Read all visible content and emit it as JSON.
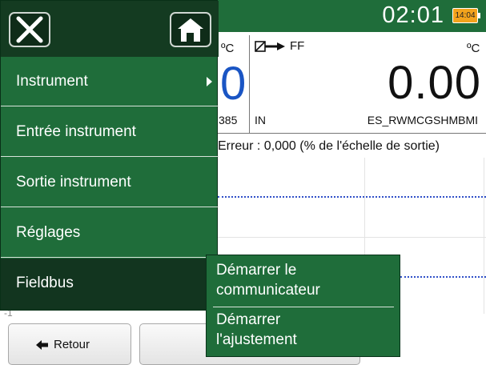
{
  "status": {
    "time": "02:01",
    "battery_text": "14:04"
  },
  "measurement": {
    "left_unit": "ºC",
    "left_value": "0",
    "left_code": "385",
    "mode_label": "FF",
    "right_unit": "ºC",
    "value": "0.00",
    "in_label": "IN",
    "tag": "ES_RWMCGSHMBMI"
  },
  "error_line": "Erreur : 0,000 (% de l'échelle de sortie)",
  "chart": {
    "axis_tick": "-1"
  },
  "menu": {
    "items": [
      {
        "label": "Instrument"
      },
      {
        "label": "Entrée instrument"
      },
      {
        "label": "Sortie instrument"
      },
      {
        "label": "Réglages"
      },
      {
        "label": "Fieldbus"
      }
    ]
  },
  "submenu": {
    "item1_line1": "Démarrer le",
    "item1_line2": "communicateur",
    "item2_line1": "Démarrer",
    "item2_line2": "l'ajustement"
  },
  "buttons": {
    "back_label": "Retour"
  },
  "colors": {
    "primary_green": "#1f6d3a",
    "dark_green": "#12351f",
    "accent_blue": "#1a55c4",
    "battery_orange": "#f3a31c"
  }
}
